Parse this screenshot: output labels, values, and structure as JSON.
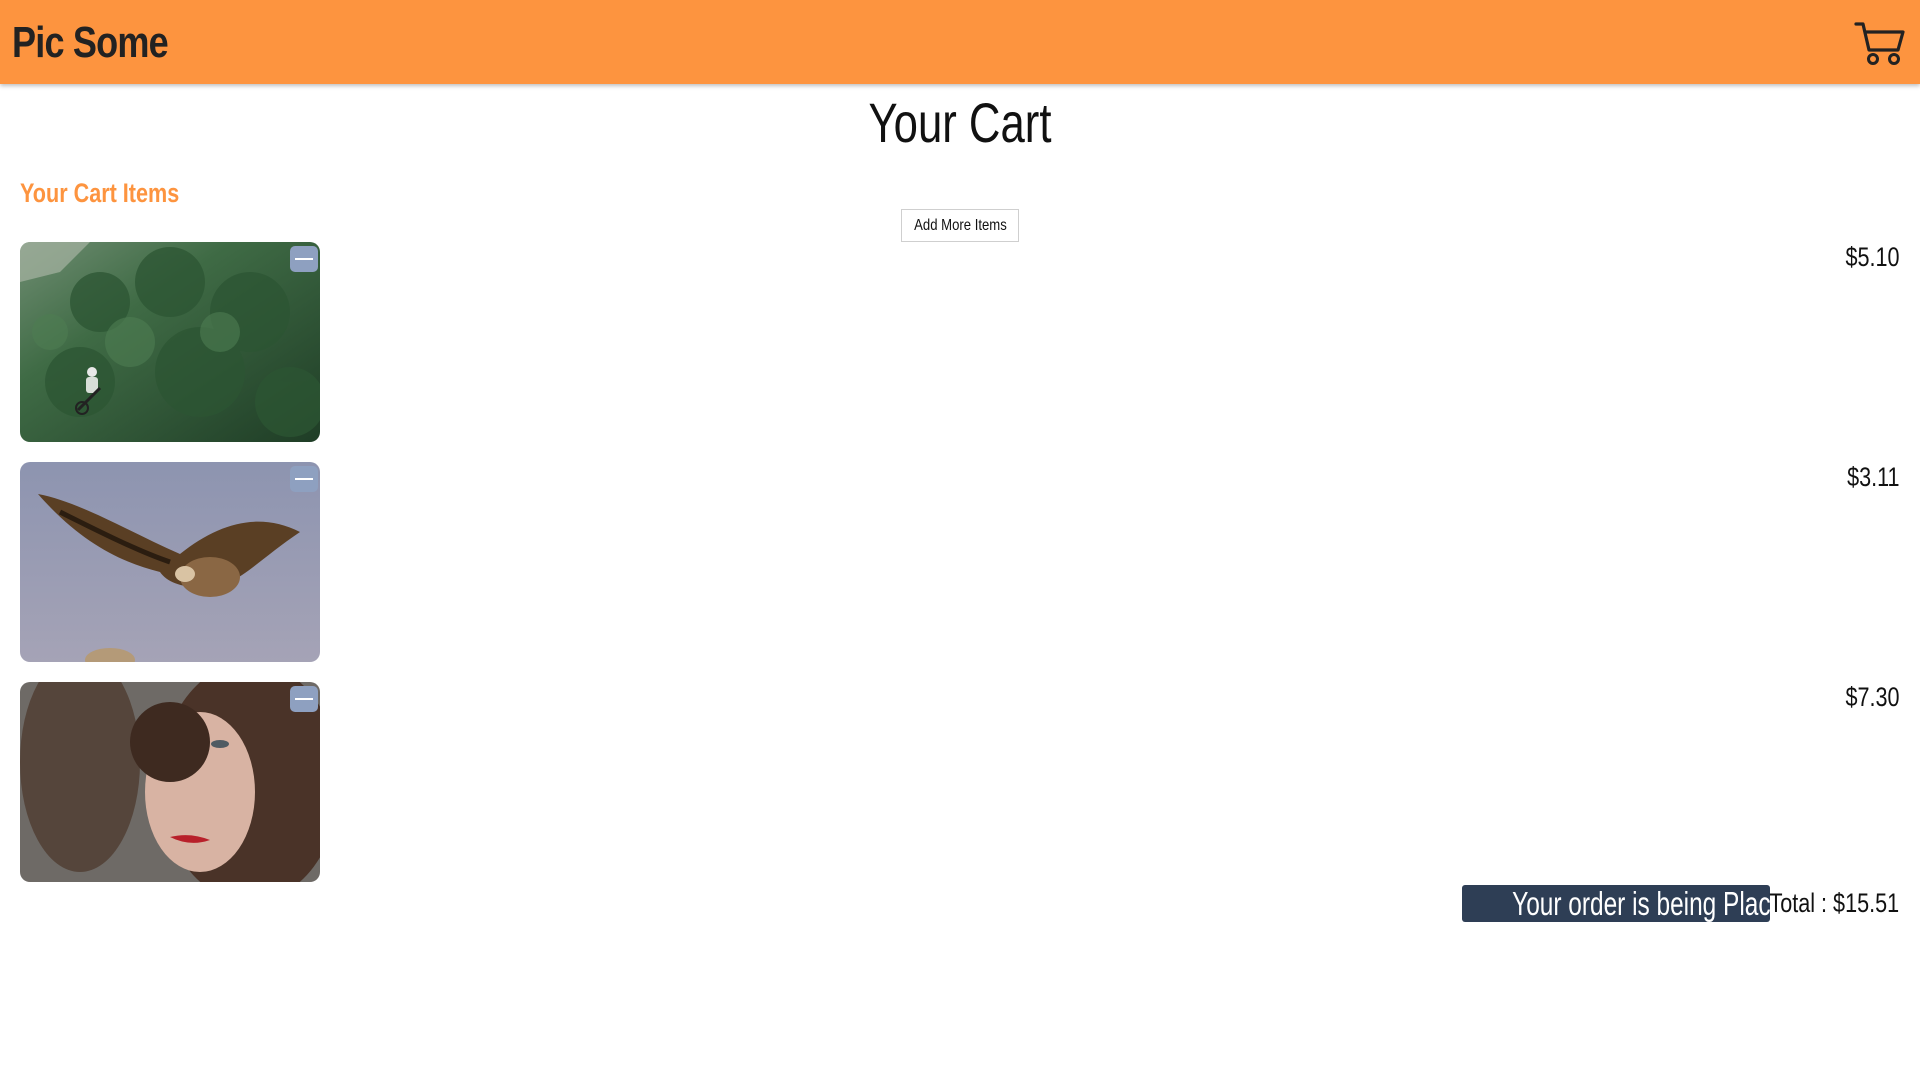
{
  "header": {
    "brand": "Pic Some",
    "cart_icon": "shopping-cart-icon"
  },
  "page": {
    "title": "Your Cart",
    "section_title": "Your Cart Items",
    "add_more_label": "Add More Items"
  },
  "cart_items": [
    {
      "image": "cyclist riding through green forest",
      "price": "$5.10"
    },
    {
      "image": "vulture in flight",
      "price": "$3.11"
    },
    {
      "image": "portrait of woman with curly hair",
      "price": "$7.30"
    }
  ],
  "footer": {
    "order_status": "Your order is being Placed",
    "total": "Total : $15.51"
  },
  "colors": {
    "header_bg": "#fd943f",
    "accent": "#fd943f",
    "order_badge_bg": "#2e3e55",
    "remove_button": "#8ea0c0"
  }
}
